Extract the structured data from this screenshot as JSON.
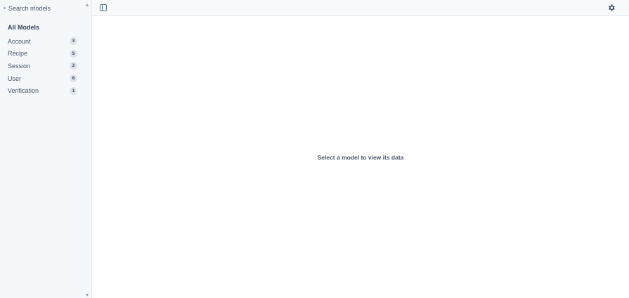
{
  "sidebar": {
    "search": {
      "placeholder": "Search models",
      "value": ""
    },
    "header": "All Models",
    "models": [
      {
        "name": "Account",
        "count": "3"
      },
      {
        "name": "Recipe",
        "count": "5"
      },
      {
        "name": "Session",
        "count": "2"
      },
      {
        "name": "User",
        "count": "6"
      },
      {
        "name": "Verification",
        "count": "1"
      }
    ]
  },
  "toolbar": {
    "toggle_icon": "sidebar-toggle-icon",
    "settings_icon": "gear-icon"
  },
  "main": {
    "empty_message": "Select a model to view its data"
  },
  "colors": {
    "sidebar_bg": "#f5f8fb",
    "badge_bg": "#dde3ea",
    "text": "#475569"
  }
}
